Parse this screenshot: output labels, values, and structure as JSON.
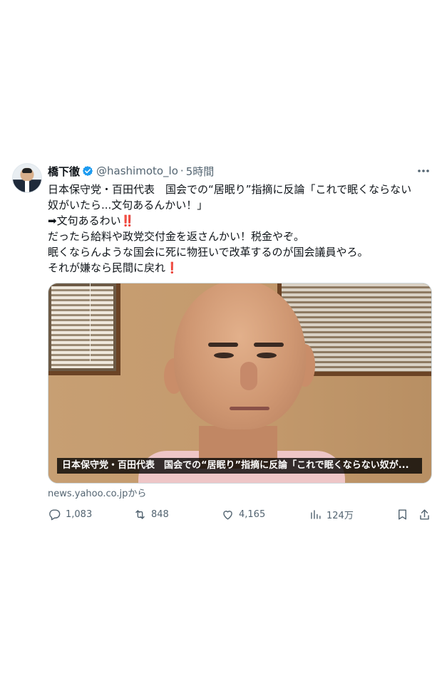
{
  "author": {
    "name": "橋下徹",
    "handle": "@hashimoto_lo",
    "separator": "·",
    "time": "5時間"
  },
  "tweet": {
    "lines": [
      "日本保守党・百田代表　国会での“居眠り”指摘に反論「これで眠くならない",
      "奴がいたら...文句あるんかい！」",
      "➡文句あるわい",
      "だったら給料や政党交付金を返さんかい！税金やぞ。",
      "眠くならんような国会に死に物狂いで改革するのが国会議員やろ。",
      "それが嫌なら民間に戻れ"
    ],
    "emoji_double_exclamation": "‼️",
    "emoji_exclamation": "❗"
  },
  "media": {
    "caption": "日本保守党・百田代表　国会での“居眠り”指摘に反論「これで眠くならない奴が...",
    "source": "news.yahoo.co.jpから"
  },
  "actions": {
    "replies": "1,083",
    "reposts": "848",
    "likes": "4,165",
    "views": "124万"
  },
  "colors": {
    "text": "#0f1419",
    "secondary": "#536471",
    "verified": "#1d9bf0",
    "emoji_red": "#dd1f26"
  }
}
